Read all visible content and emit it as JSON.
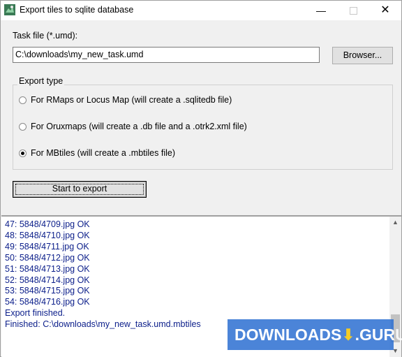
{
  "window": {
    "title": "Export tiles to sqlite database",
    "minimize_label": "—",
    "close_label": "✕"
  },
  "task_file": {
    "label": "Task file (*.umd):",
    "value": "C:\\downloads\\my_new_task.umd",
    "browse_label": "Browser..."
  },
  "export_type": {
    "legend": "Export type",
    "options": [
      {
        "label": "For RMaps or Locus Map   (will create a .sqlitedb file)",
        "checked": false
      },
      {
        "label": "For Oruxmaps   (will create a .db file and a .otrk2.xml file)",
        "checked": false
      },
      {
        "label": "For MBtiles   (will create a .mbtiles file)",
        "checked": true
      }
    ]
  },
  "start_button_label": "Start to export",
  "log": [
    "47: 5848/4709.jpg OK",
    "48: 5848/4710.jpg OK",
    "49: 5848/4711.jpg OK",
    "50: 5848/4712.jpg OK",
    "51: 5848/4713.jpg OK",
    "52: 5848/4714.jpg OK",
    "53: 5848/4715.jpg OK",
    "54: 5848/4716.jpg OK",
    "Export finished.",
    "Finished: C:\\downloads\\my_new_task.umd.mbtiles"
  ],
  "scrollbar": {
    "up_glyph": "▲",
    "down_glyph": "▼"
  },
  "watermark": {
    "text_before": "DOWNLOADS",
    "arrow": "⬇",
    "text_after": ".GURU"
  },
  "colors": {
    "log_text": "#0b1e8a",
    "watermark_bg": "#2c6fd2",
    "watermark_accent": "#f2c200"
  }
}
